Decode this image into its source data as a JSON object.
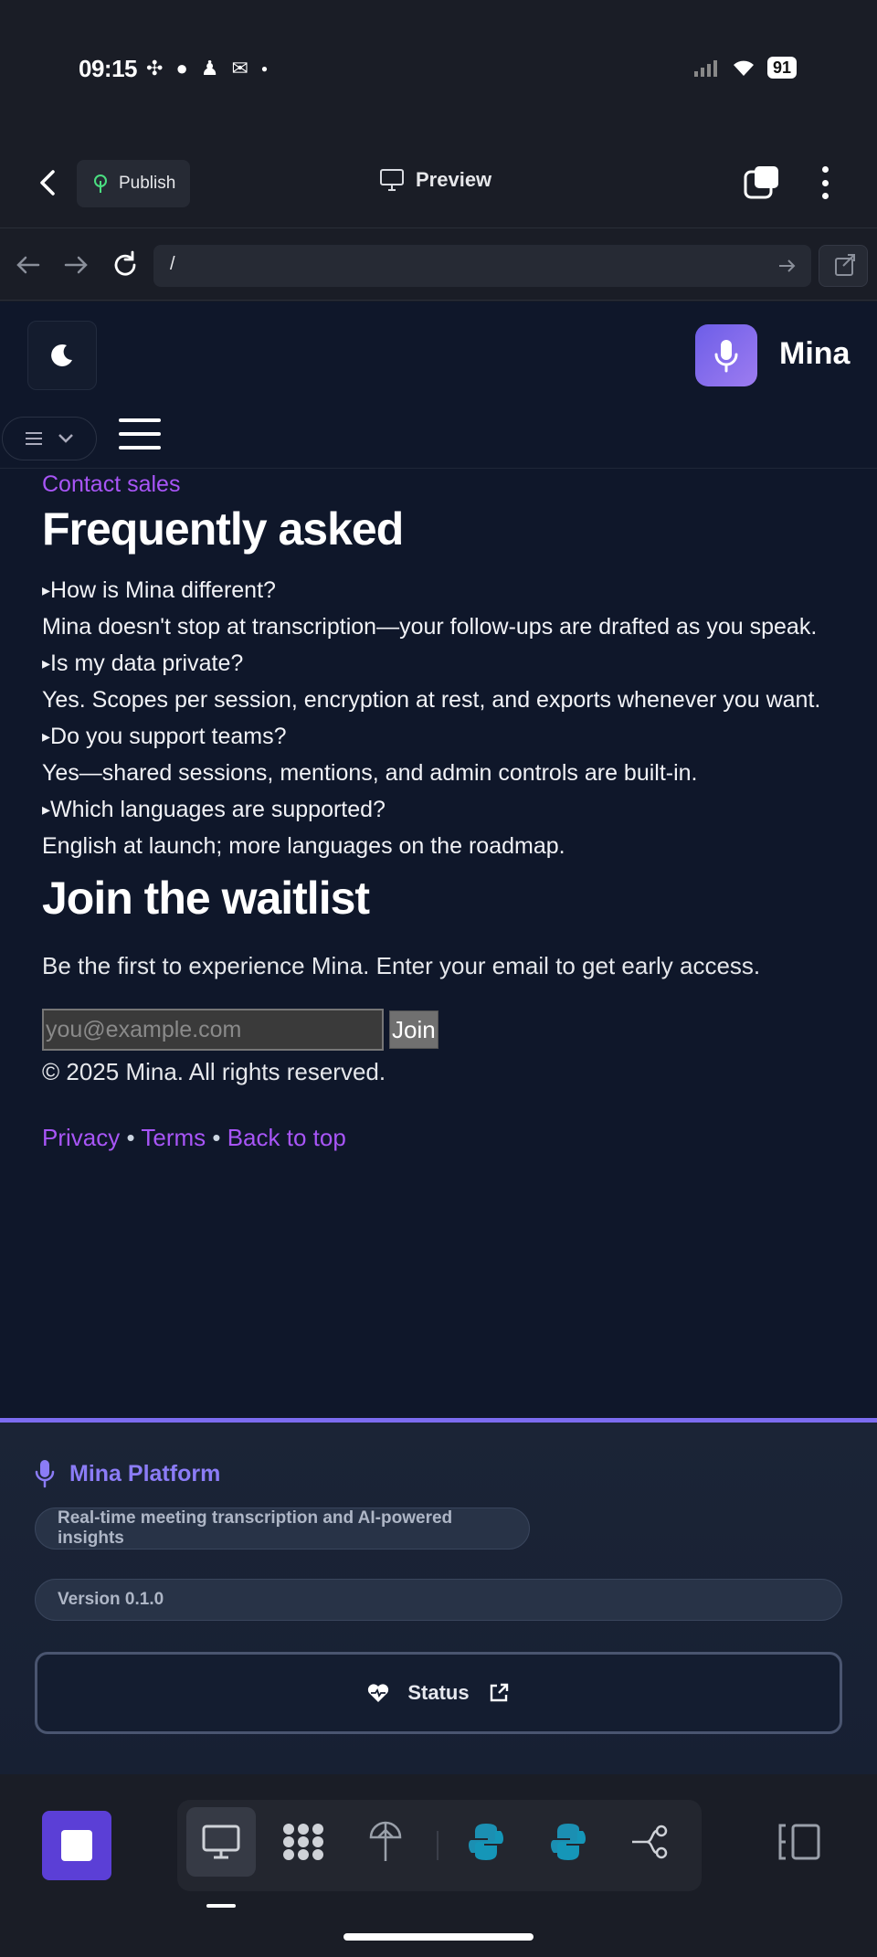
{
  "status_bar": {
    "time": "09:15",
    "notification_icons": [
      "slack-icon",
      "chat-icon",
      "snapchat-icon",
      "mail-icon",
      "dot-icon"
    ],
    "battery": "91"
  },
  "app_bar": {
    "publish_label": "Publish",
    "preview_label": "Preview"
  },
  "url_bar": {
    "url": "/"
  },
  "site": {
    "brand_name": "Mina",
    "contact_link": "Contact sales",
    "faq_title": "Frequently asked",
    "faq": [
      {
        "q": "How is Mina different?",
        "a": "Mina doesn't stop at transcription—your follow-ups are drafted as you speak."
      },
      {
        "q": "Is my data private?",
        "a": "Yes. Scopes per session, encryption at rest, and exports whenever you want."
      },
      {
        "q": "Do you support teams?",
        "a": "Yes—shared sessions, mentions, and admin controls are built-in."
      },
      {
        "q": "Which languages are supported?",
        "a": "English at launch; more languages on the roadmap."
      }
    ],
    "waitlist_title": "Join the waitlist",
    "waitlist_desc": "Be the first to experience Mina. Enter your email to get early access.",
    "email_placeholder": "you@example.com",
    "join_label": "Join",
    "copyright": "© 2025 Mina. All rights reserved.",
    "links": {
      "privacy": "Privacy",
      "terms": "Terms",
      "back_to_top": "Back to top",
      "separator": "•"
    }
  },
  "platform": {
    "title": "Mina Platform",
    "description": "Real-time meeting transcription and AI-powered insights",
    "version": "Version 0.1.0",
    "status_label": "Status"
  },
  "dock": {
    "tools": [
      "desktop-icon",
      "nodes-icon",
      "deploy-icon",
      "python-icon",
      "python-icon",
      "git-branch-icon"
    ]
  },
  "colors": {
    "accent": "#a855f7",
    "brand_gradient": "#6d5ee8",
    "platform_accent": "#8b7cf6",
    "page_bg": "#0f172a",
    "stop_button": "#5b3fd6"
  }
}
